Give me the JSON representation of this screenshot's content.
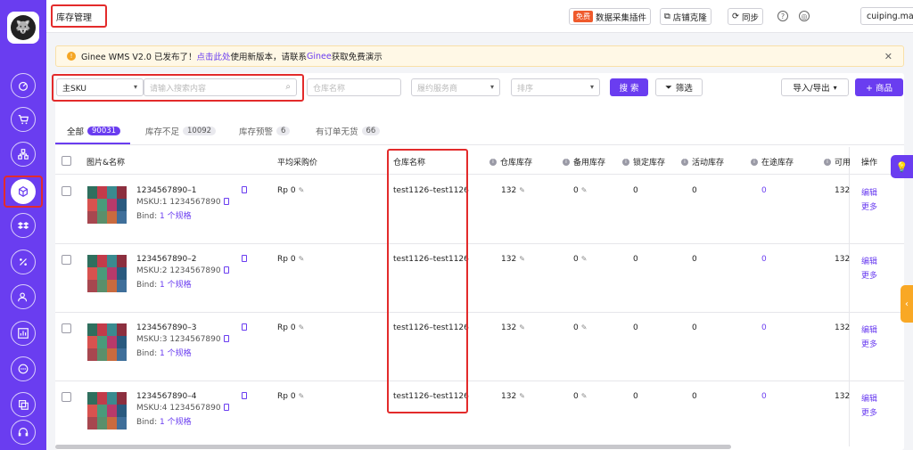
{
  "header": {
    "title": "库存管理",
    "free_badge": "免费",
    "plugin_label": "数据采集插件",
    "clone_label": "店铺克隆",
    "sync_label": "同步",
    "user": "cuiping.ma@a..."
  },
  "notice": {
    "prefix": "Ginee WMS V2.0 已发布了！",
    "link": "点击此处",
    "middle": "使用新版本，请联系",
    "brand": "Ginee",
    "suffix": " 获取免费演示"
  },
  "filters": {
    "sku_type": "主SKU",
    "search_placeholder": "请输入搜索内容",
    "warehouse_placeholder": "仓库名称",
    "service_placeholder": "履约服务商",
    "sort_placeholder": "排序",
    "search_btn": "搜 索",
    "filter_btn": "筛选",
    "import_export": "导入/导出",
    "add_product": "+ 商品"
  },
  "tabs": [
    {
      "label": "全部",
      "count": "90031"
    },
    {
      "label": "库存不足",
      "count": "10092"
    },
    {
      "label": "库存预警",
      "count": "6"
    },
    {
      "label": "有订单无货",
      "count": "66"
    }
  ],
  "columns": {
    "image_name": "图片&名称",
    "avg_price": "平均采购价",
    "warehouse": "仓库名称",
    "wh_stock": "仓库库存",
    "backup_stock": "备用库存",
    "locked_stock": "锁定库存",
    "promo_stock": "活动库存",
    "transit_stock": "在途库存",
    "available": "可用",
    "ops": "操作"
  },
  "rows": [
    {
      "name": "1234567890–1",
      "msku": "MSKU:1 1234567890",
      "bind_prefix": "Bind:",
      "bind_link": "1 个规格",
      "price": "Rp 0",
      "warehouse": "test1126–test1126",
      "wh_stock": "132",
      "backup": "0",
      "locked": "0",
      "promo": "0",
      "transit": "0",
      "available": "132",
      "edit": "编辑",
      "more": "更多"
    },
    {
      "name": "1234567890–2",
      "msku": "MSKU:2 1234567890",
      "bind_prefix": "Bind:",
      "bind_link": "1 个规格",
      "price": "Rp 0",
      "warehouse": "test1126–test1126",
      "wh_stock": "132",
      "backup": "0",
      "locked": "0",
      "promo": "0",
      "transit": "0",
      "available": "132",
      "edit": "编辑",
      "more": "更多"
    },
    {
      "name": "1234567890–3",
      "msku": "MSKU:3 1234567890",
      "bind_prefix": "Bind:",
      "bind_link": "1 个规格",
      "price": "Rp 0",
      "warehouse": "test1126–test1126",
      "wh_stock": "132",
      "backup": "0",
      "locked": "0",
      "promo": "0",
      "transit": "0",
      "available": "132",
      "edit": "编辑",
      "more": "更多"
    },
    {
      "name": "1234567890–4",
      "msku": "MSKU:4 1234567890",
      "bind_prefix": "Bind:",
      "bind_link": "1 个规格",
      "price": "Rp 0",
      "warehouse": "test1126–test1126",
      "wh_stock": "132",
      "backup": "0",
      "locked": "0",
      "promo": "0",
      "transit": "0",
      "available": "132",
      "edit": "编辑",
      "more": "更多"
    }
  ],
  "colors": {
    "accent": "#6a3df0",
    "highlight": "#e32b2b",
    "warning": "#f5a623"
  }
}
